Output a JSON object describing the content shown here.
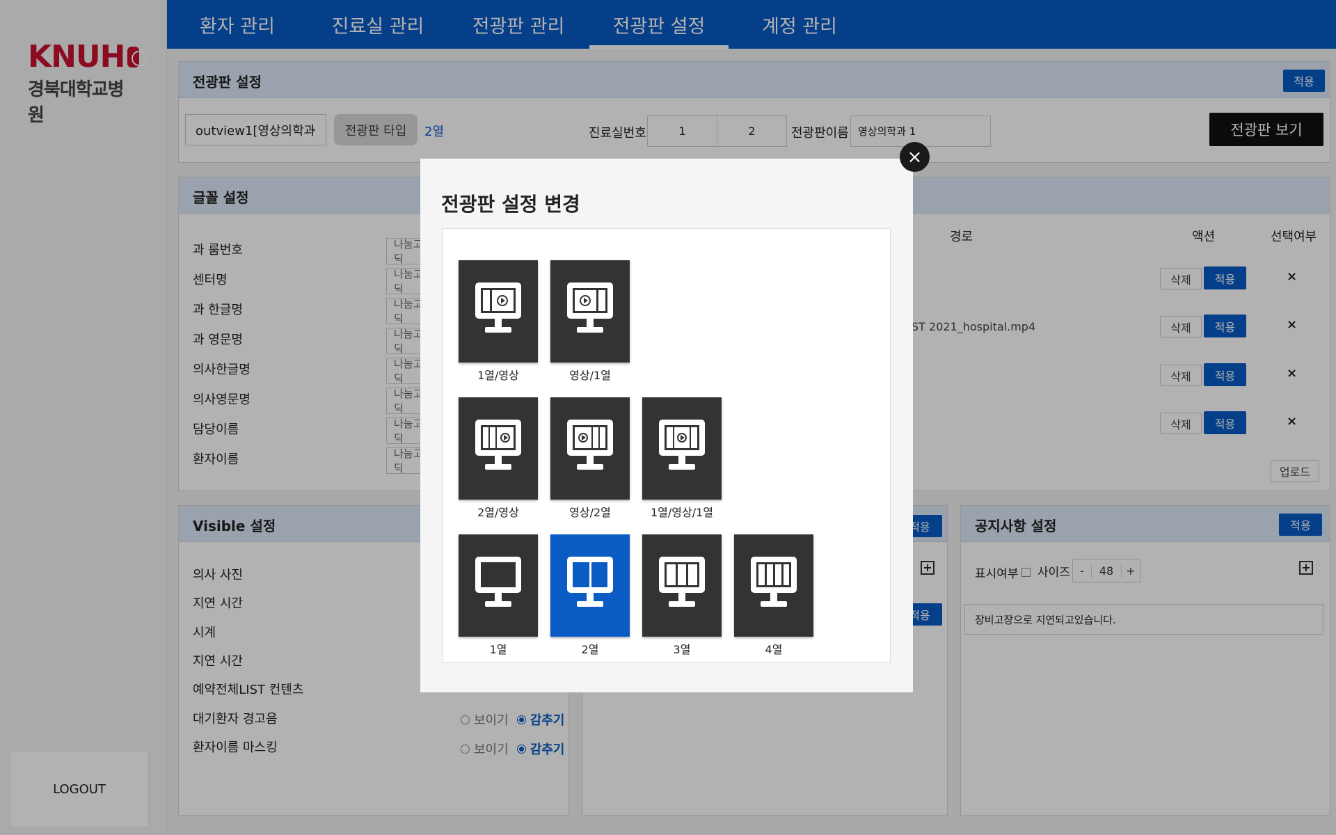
{
  "brand": {
    "logo_top": "KNUH",
    "logo_bottom": "경북대학교병원"
  },
  "sidebar": {
    "logout_label": "LOGOUT"
  },
  "nav": {
    "tabs": [
      {
        "label": "환자 관리"
      },
      {
        "label": "진료실 관리"
      },
      {
        "label": "전광판 관리"
      },
      {
        "label": "전광판 설정",
        "active": true
      },
      {
        "label": "계정 관리"
      }
    ]
  },
  "board_panel": {
    "title": "전광판 설정",
    "apply_label": "적용",
    "select_value": "outview1[영상의학과",
    "type_button": "전광판 타입",
    "type_value": "2열",
    "room_label": "진료실번호",
    "room_values": [
      "1",
      "2"
    ],
    "name_label": "전광판이름",
    "name_value": "영상의학과 1",
    "view_button": "전광판 보기"
  },
  "font_panel": {
    "title": "글꼴 설정",
    "rows": [
      "과 룸번호",
      "센터명",
      "과 한글명",
      "과 영문명",
      "의사한글명",
      "의사영문명",
      "담당이름",
      "환자이름"
    ],
    "font_value": "나눔고딕",
    "col_path": "경로",
    "col_action": "액션",
    "col_select": "선택여부",
    "media_rows": [
      {
        "path": ""
      },
      {
        "path": "ST 2021_hospital.mp4"
      },
      {
        "path": ""
      },
      {
        "path": ""
      }
    ],
    "delete_label": "삭제",
    "apply_label": "적용",
    "remove_mark": "×",
    "upload_label": "업로드"
  },
  "visible_panel": {
    "title": "Visible 설정",
    "rows": [
      {
        "label": "의사 사진"
      },
      {
        "label": "지연 시간"
      },
      {
        "label": "시계"
      },
      {
        "label": "지연 시간"
      },
      {
        "label": "예약전체LIST 컨텐츠"
      },
      {
        "label": "대기환자 경고음"
      },
      {
        "label": "환자이름 마스킹"
      }
    ],
    "show_label": "보이기",
    "hide_label": "감추기"
  },
  "middle_panel": {
    "apply_label": "적용"
  },
  "notice_panel": {
    "title": "공지사항 설정",
    "apply_label": "적용",
    "show_label": "표시여부",
    "size_label": "사이즈",
    "minus": "-",
    "size_value": "48",
    "plus": "+",
    "notice_text": "장비고장으로 지연되고있습니다."
  },
  "modal": {
    "title": "전광판 설정 변경",
    "close_glyph": "×",
    "options": [
      {
        "label": "1열/영상",
        "icon": "layout-1col-video-icon"
      },
      {
        "label": "영상/1열",
        "icon": "layout-video-1col-icon"
      },
      {
        "label": "2열/영상",
        "icon": "layout-2col-video-icon"
      },
      {
        "label": "영상/2열",
        "icon": "layout-video-2col-icon"
      },
      {
        "label": "1열/영상/1열",
        "icon": "layout-1col-video-1col-icon"
      },
      {
        "label": "1열",
        "icon": "layout-1col-icon"
      },
      {
        "label": "2열",
        "icon": "layout-2col-icon",
        "selected": true
      },
      {
        "label": "3열",
        "icon": "layout-3col-icon"
      },
      {
        "label": "4열",
        "icon": "layout-4col-icon"
      }
    ]
  },
  "colors": {
    "primary": "#0a5bc4",
    "tile": "#333333",
    "tile_selected": "#0a5bc4",
    "logo": "#c8102e"
  }
}
